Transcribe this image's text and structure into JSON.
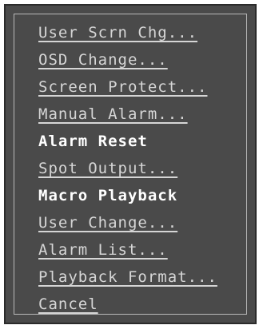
{
  "menu": {
    "items": [
      {
        "label": "User Scrn Chg..."
      },
      {
        "label": "OSD Change..."
      },
      {
        "label": "Screen Protect..."
      },
      {
        "label": "Manual Alarm..."
      },
      {
        "label": "Alarm Reset"
      },
      {
        "label": "Spot Output..."
      },
      {
        "label": "Macro Playback"
      },
      {
        "label": "User Change..."
      },
      {
        "label": "Alarm List..."
      },
      {
        "label": "Playback Format..."
      },
      {
        "label": "Cancel"
      }
    ]
  },
  "colors": {
    "panel_background": "#4a4a4a",
    "link_text": "#d6d6d6",
    "plain_text": "#ffffff"
  }
}
